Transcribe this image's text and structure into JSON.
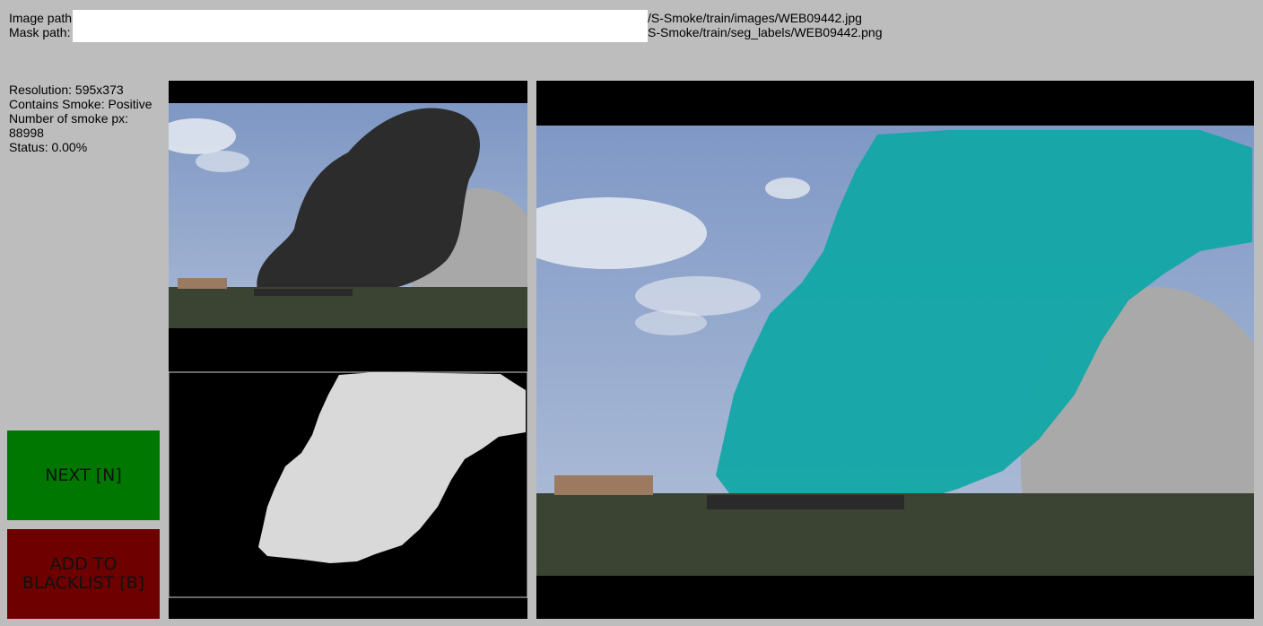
{
  "paths": {
    "image_label": "Image path",
    "image_value": "/S-Smoke/train/images/WEB09442.jpg",
    "mask_label": "Mask path:",
    "mask_value": "S-Smoke/train/seg_labels/WEB09442.png"
  },
  "info": {
    "resolution": "Resolution: 595x373",
    "contains_smoke": "Contains Smoke: Positive",
    "smoke_px_label": "Number of smoke px:",
    "smoke_px_value": "88998",
    "status": "Status: 0.00%"
  },
  "buttons": {
    "next": "NEXT [N]",
    "blacklist": "ADD TO BLACKLIST [B]"
  },
  "colors": {
    "background": "#bdbdbd",
    "next_button": "#007700",
    "blacklist_button": "#6e0000",
    "mask_fill": "#d9d9d9",
    "overlay_fill": "#12a6a6"
  }
}
